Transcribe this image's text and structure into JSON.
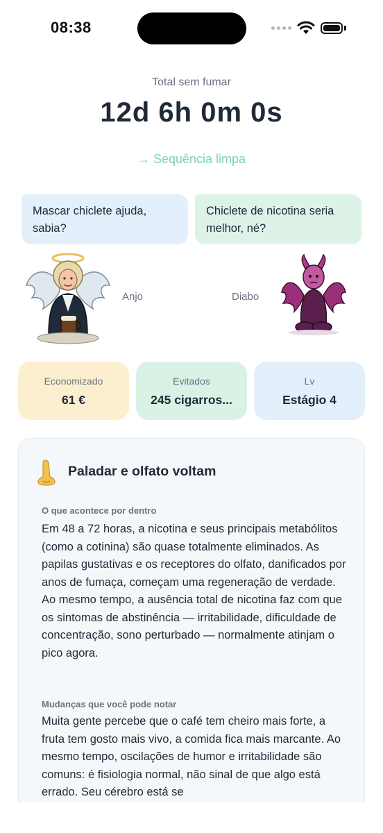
{
  "status_bar": {
    "time": "08:38"
  },
  "header": {
    "label": "Total sem fumar",
    "counter": "12d 6h 0m 0s",
    "streak": "→ Sequência limpa"
  },
  "bubbles": {
    "angel": "Mascar chiclete ajuda, sabia?",
    "devil": "Chiclete de nicotina seria melhor, né?"
  },
  "characters": {
    "angel_name": "Anjo",
    "devil_name": "Diabo"
  },
  "stats": [
    {
      "label": "Economizado",
      "value": "61 €",
      "color": "#fcefcf"
    },
    {
      "label": "Evitados",
      "value": "245 cigarros...",
      "color": "#d9f2e5"
    },
    {
      "label": "Lv",
      "value": "Estágio 4",
      "color": "#e3f0fb"
    }
  ],
  "info_card": {
    "icon": "nose-icon",
    "title": "Paladar e olfato voltam",
    "sections": [
      {
        "title": "O que acontece por dentro",
        "text": "Em 48 a 72 horas, a nicotina e seus principais metabólitos (como a cotinina) são quase totalmente eliminados. As papilas gustativas e os receptores do olfato, danificados por anos de fumaça, começam uma regeneração de verdade. Ao mesmo tempo, a ausência total de nicotina faz com que os sintomas de abstinência — irritabilidade, dificuldade de concentração, sono perturbado — normalmente atinjam o pico agora."
      },
      {
        "title": "Mudanças que você pode notar",
        "text": "Muita gente percebe que o café tem cheiro mais forte, a fruta tem gosto mais vivo, a comida fica mais marcante. Ao mesmo tempo, oscilações de humor e irritabilidade são comuns: é fisiologia normal, não sinal de que algo está errado. Seu cérebro está se"
      }
    ]
  },
  "colors": {
    "accent_green": "#7fd3a9",
    "angel_bubble": "#e3f0fb",
    "devil_bubble": "#ddf3e8"
  }
}
